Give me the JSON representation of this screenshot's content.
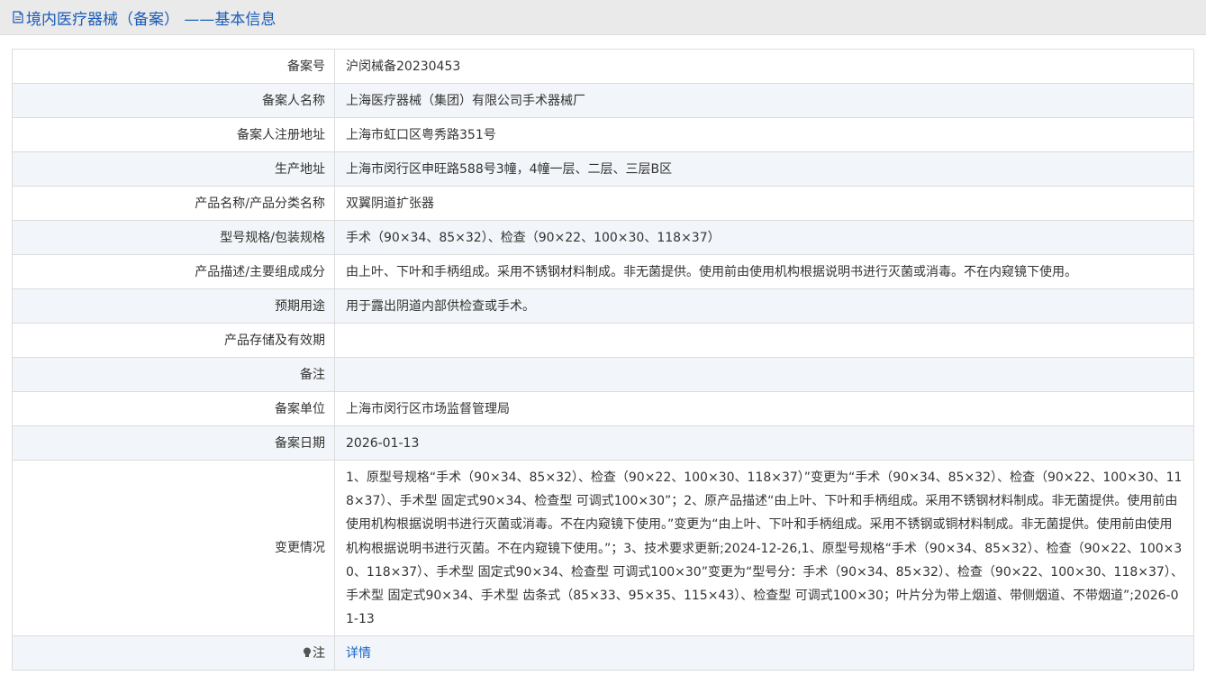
{
  "header": {
    "title": "境内医疗器械（备案） ——基本信息"
  },
  "rows": [
    {
      "label": "备案号",
      "value": "沪闵械备20230453"
    },
    {
      "label": "备案人名称",
      "value": "上海医疗器械（集团）有限公司手术器械厂"
    },
    {
      "label": "备案人注册地址",
      "value": "上海市虹口区粤秀路351号"
    },
    {
      "label": "生产地址",
      "value": "上海市闵行区申旺路588号3幢，4幢一层、二层、三层B区"
    },
    {
      "label": "产品名称/产品分类名称",
      "value": "双翼阴道扩张器"
    },
    {
      "label": "型号规格/包装规格",
      "value": "手术（90×34、85×32）、检查（90×22、100×30、118×37）"
    },
    {
      "label": "产品描述/主要组成成分",
      "value": "由上叶、下叶和手柄组成。采用不锈钢材料制成。非无菌提供。使用前由使用机构根据说明书进行灭菌或消毒。不在内窥镜下使用。"
    },
    {
      "label": "预期用途",
      "value": "用于露出阴道内部供检查或手术。"
    },
    {
      "label": "产品存储及有效期",
      "value": ""
    },
    {
      "label": "备注",
      "value": ""
    },
    {
      "label": "备案单位",
      "value": "上海市闵行区市场监督管理局"
    },
    {
      "label": "备案日期",
      "value": "2026-01-13"
    },
    {
      "label": "变更情况",
      "value": "1、原型号规格“手术（90×34、85×32）、检查（90×22、100×30、118×37）”变更为“手术（90×34、85×32）、检查（90×22、100×30、118×37）、手术型 固定式90×34、检查型 可调式100×30”；2、原产品描述“由上叶、下叶和手柄组成。采用不锈钢材料制成。非无菌提供。使用前由使用机构根据说明书进行灭菌或消毒。不在内窥镜下使用。”变更为“由上叶、下叶和手柄组成。采用不锈钢或铜材料制成。非无菌提供。使用前由使用机构根据说明书进行灭菌。不在内窥镜下使用。”；3、技术要求更新;2024-12-26,1、原型号规格“手术（90×34、85×32）、检查（90×22、100×30、118×37）、手术型 固定式90×34、检查型 可调式100×30”变更为“型号分：手术（90×34、85×32）、检查（90×22、100×30、118×37）、手术型 固定式90×34、手术型 齿条式（85×33、95×35、115×43）、检查型 可调式100×30；叶片分为带上烟道、带侧烟道、不带烟道”;2026-01-13"
    }
  ],
  "note": {
    "label": "注",
    "icon": "lightbulb-icon",
    "link_text": "详情"
  }
}
